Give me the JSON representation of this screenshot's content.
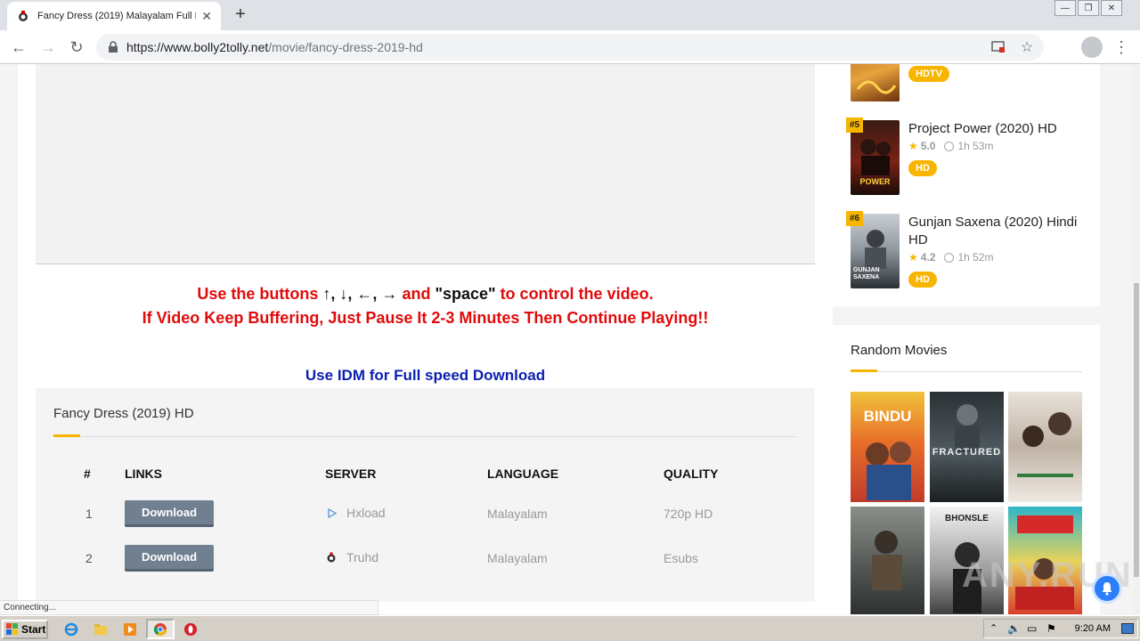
{
  "browser": {
    "tab_title": "Fancy Dress (2019) Malayalam Full M",
    "url_host": "https://www.bolly2tolly.net",
    "url_path": "/movie/fancy-dress-2019-hd"
  },
  "page": {
    "notice_line1_a": "Use the buttons ",
    "notice_line1_keys": "↑, ↓, ←, →",
    "notice_line1_b": " and ",
    "notice_line1_space": "\"space\"",
    "notice_line1_c": " to control the video.",
    "notice_line2": "If Video Keep Buffering, Just Pause It 2-3 Minutes Then Continue Playing!!",
    "idm_text": "Use IDM for Full speed Download",
    "links": {
      "title": "Fancy Dress (2019) HD",
      "headers": [
        "#",
        "LINKS",
        "SERVER",
        "LANGUAGE",
        "QUALITY"
      ],
      "rows": [
        {
          "num": "1",
          "button": "Download",
          "server": "Hxload",
          "language": "Malayalam",
          "quality": "720p HD"
        },
        {
          "num": "2",
          "button": "Download",
          "server": "Truhd",
          "language": "Malayalam",
          "quality": "Esubs"
        }
      ]
    }
  },
  "sidebar": {
    "top_items": [
      {
        "badge": "HDTV"
      },
      {
        "rank": "#5",
        "title": "Project Power (2020) HD",
        "rating": "5.0",
        "duration": "1h 53m",
        "badge": "HD"
      },
      {
        "rank": "#6",
        "title": "Gunjan Saxena (2020) Hindi HD",
        "rating": "4.2",
        "duration": "1h 52m",
        "badge": "HD"
      }
    ],
    "random_title": "Random Movies",
    "poster_texts": {
      "power": "POWER",
      "gunjan": "GUNJAN SAXENA",
      "bindu": "BINDU",
      "fractured": "FRACTURED",
      "bhonsle": "BHONSLE"
    }
  },
  "status_text": "Connecting...",
  "taskbar": {
    "start_label": "Start",
    "clock": "9:20 AM"
  },
  "watermark": "ANY.RUN",
  "colors": {
    "accent": "#f7b500",
    "notice_red": "#e00b0b",
    "idm_blue": "#0a1fb0",
    "button_gray": "#708090"
  }
}
